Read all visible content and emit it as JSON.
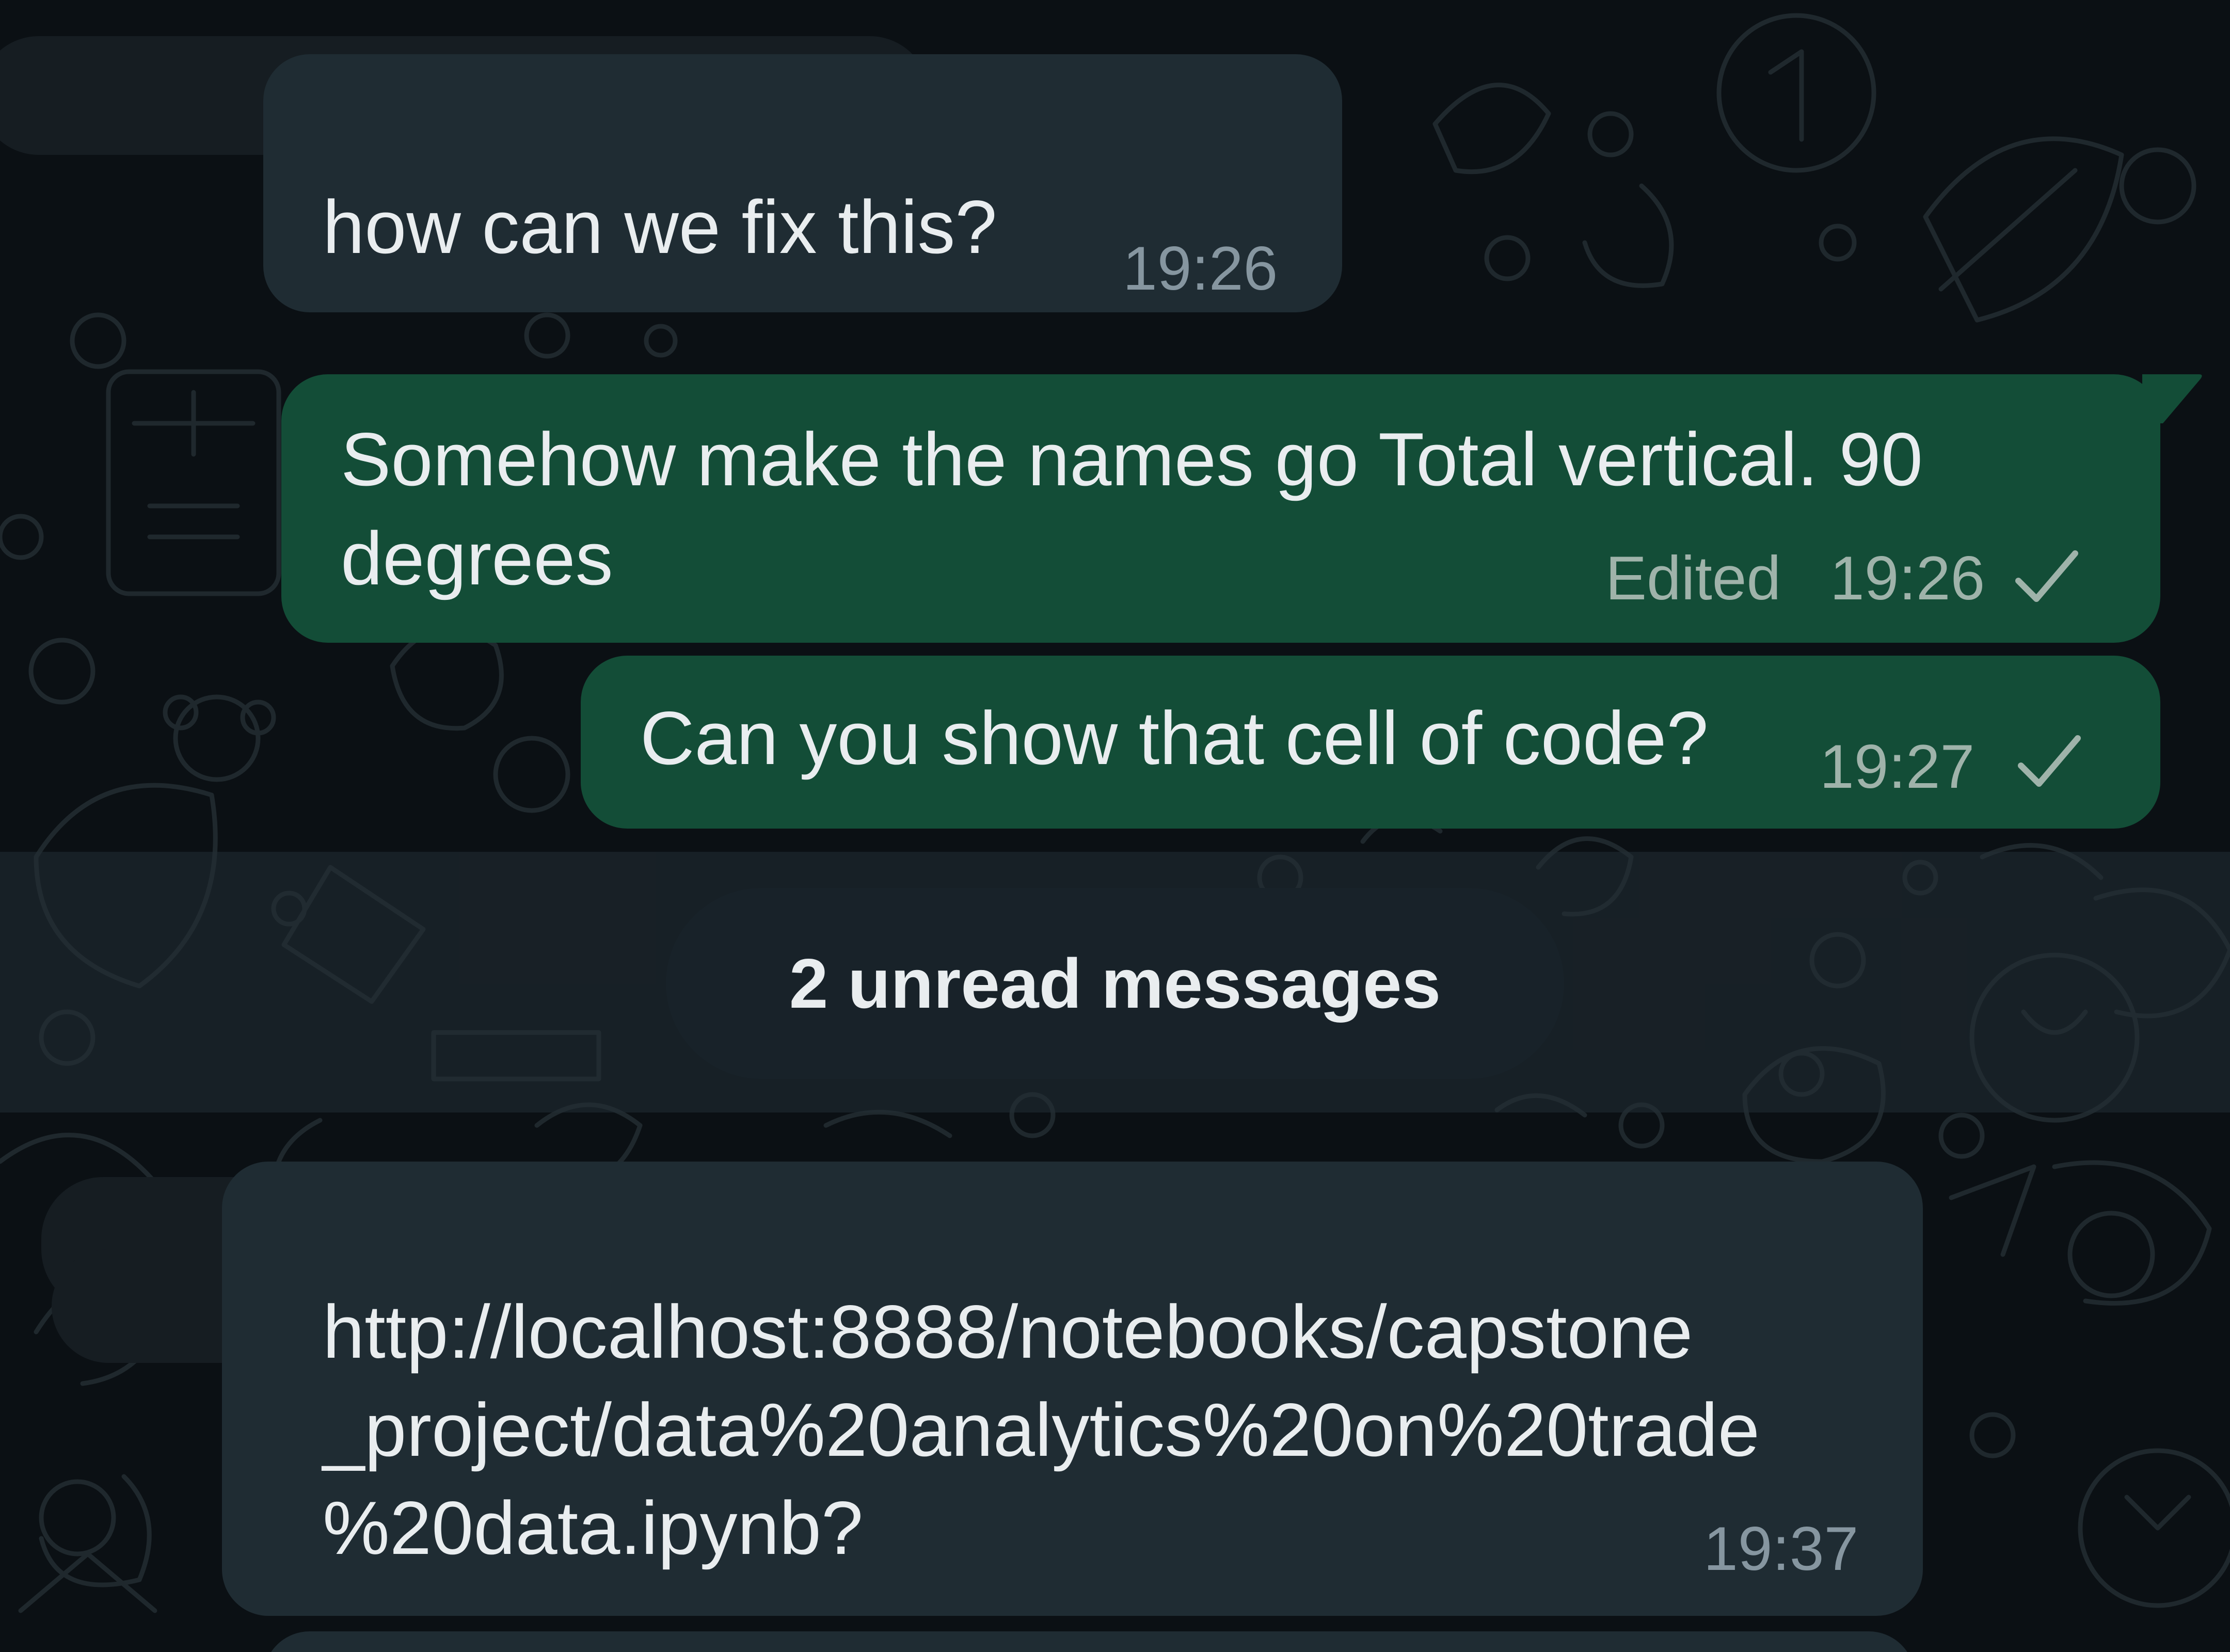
{
  "messages": [
    {
      "direction": "incoming",
      "text": "how can we fix this?",
      "time": "19:26"
    },
    {
      "direction": "outgoing",
      "text_line1": "Somehow make the names go Total vertical. 90",
      "text_line2": "degrees",
      "edited_label": "Edited",
      "time": "19:26",
      "status_icon": "single-check-icon"
    },
    {
      "direction": "outgoing",
      "text": "Can you show that cell of code?",
      "time": "19:27",
      "status_icon": "single-check-icon"
    },
    {
      "direction": "incoming",
      "text_line1": "http://localhost:8888/notebooks/capstone",
      "text_line2": "_project/data%20analytics%20on%20trade",
      "text_line3": "%20data.ipynb?",
      "time": "19:37"
    }
  ],
  "unread_divider": {
    "label": "2 unread messages"
  },
  "colors": {
    "background": "#0b1014",
    "incoming_bubble": "#1f2c33",
    "outgoing_bubble": "#134d37",
    "text": "#e9edef",
    "meta_text": "#8696a0"
  }
}
